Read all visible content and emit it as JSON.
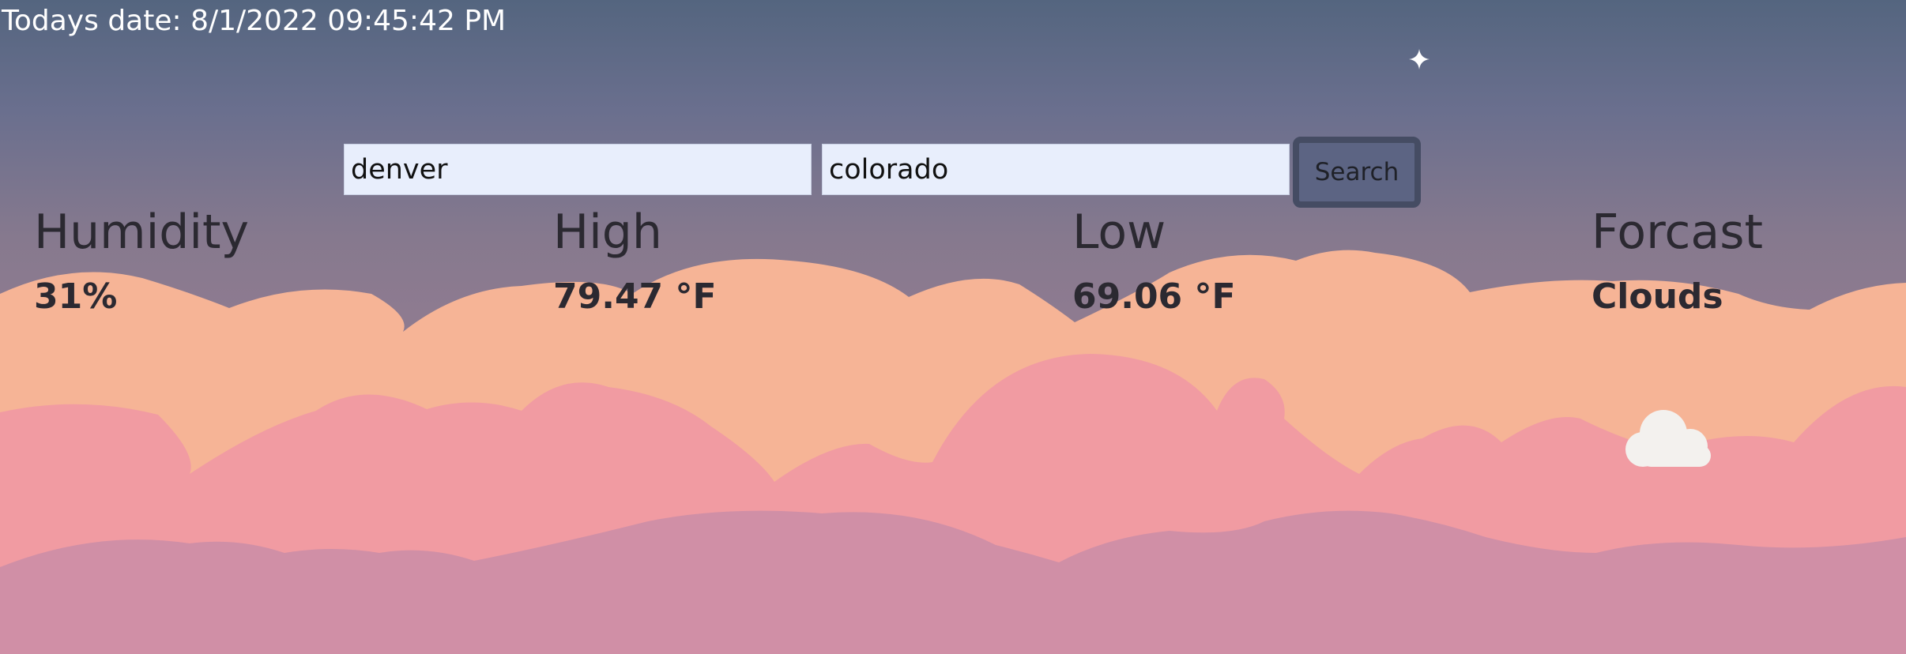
{
  "header": {
    "date_label": "Todays date: 8/1/2022 09:45:42 PM"
  },
  "search": {
    "city_value": "denver",
    "state_value": "colorado",
    "button_label": "Search"
  },
  "weather": {
    "humidity": {
      "label": "Humidity",
      "value": "31%"
    },
    "high": {
      "label": "High",
      "value": "79.47 °F"
    },
    "low": {
      "label": "Low",
      "value": "69.06 °F"
    },
    "forecast": {
      "label": "Forcast",
      "value": "Clouds",
      "icon": "cloud-icon"
    }
  },
  "colors": {
    "sky_top": "#54657f",
    "cloud_peach": "#f6b496",
    "cloud_pink": "#f19ba2",
    "cloud_mauve": "#d08fa6",
    "text_dark": "#2b2931"
  }
}
